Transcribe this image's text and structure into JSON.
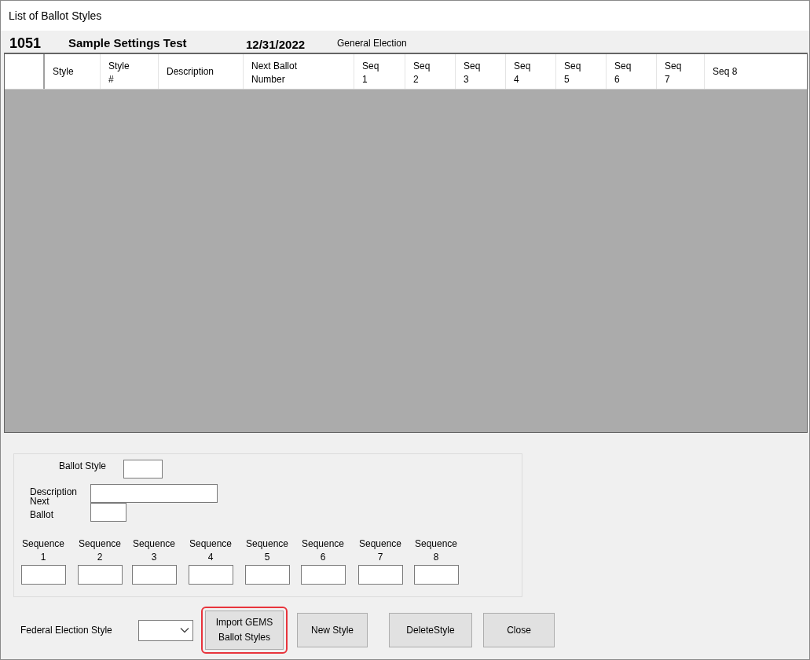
{
  "window": {
    "title": "List of Ballot Styles"
  },
  "header": {
    "number": "1051",
    "name": "Sample Settings Test",
    "date": "12/31/2022",
    "election_type": "General Election"
  },
  "table": {
    "columns": [
      {
        "label": "Style"
      },
      {
        "label": "Style\n#"
      },
      {
        "label": "Description"
      },
      {
        "label": "Next Ballot\nNumber"
      },
      {
        "label": "Seq\n1"
      },
      {
        "label": "Seq\n2"
      },
      {
        "label": "Seq\n3"
      },
      {
        "label": "Seq\n4"
      },
      {
        "label": "Seq\n5"
      },
      {
        "label": "Seq\n6"
      },
      {
        "label": "Seq\n7"
      },
      {
        "label": "Seq 8"
      }
    ]
  },
  "form": {
    "fields": [
      {
        "label": "Ballot Style",
        "kind": "short"
      },
      {
        "label": "Description",
        "kind": "wide"
      },
      {
        "label": "Next\nBallot",
        "kind": "small"
      }
    ],
    "sequences": [
      "Sequence\n1",
      "Sequence\n2",
      "Sequence\n3",
      "Sequence\n4",
      "Sequence\n5",
      "Sequence\n6",
      "Sequence\n7",
      "Sequence\n8"
    ]
  },
  "federal_election_style": {
    "label": "Federal Election Style"
  },
  "buttons": [
    {
      "label": "Import GEMS\nBallot Styles",
      "highlighted": true
    },
    {
      "label": "New Style",
      "highlighted": false
    },
    {
      "label": "DeleteStyle",
      "highlighted": false
    },
    {
      "label": "Close",
      "highlighted": false
    }
  ]
}
